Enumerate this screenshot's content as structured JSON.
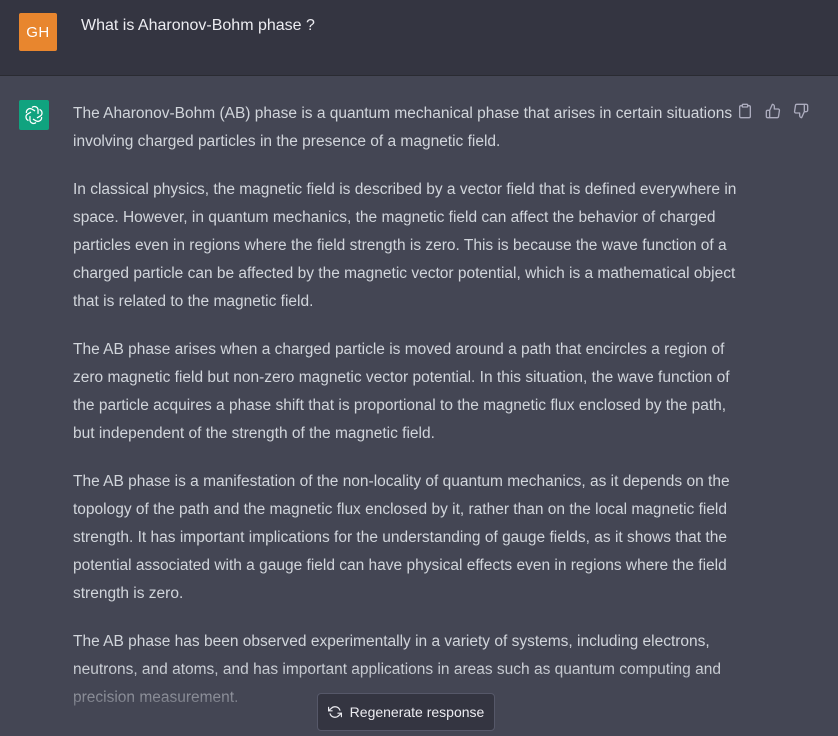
{
  "user": {
    "avatar_initials": "GH",
    "avatar_color": "#e8862e",
    "question": "What is Aharonov-Bohm phase ?"
  },
  "assistant": {
    "avatar_icon": "openai-logo-icon",
    "avatar_color": "#10a37f",
    "paragraphs": [
      "The Aharonov-Bohm (AB) phase is a quantum mechanical phase that arises in certain situations involving charged particles in the presence of a magnetic field.",
      "In classical physics, the magnetic field is described by a vector field that is defined everywhere in space. However, in quantum mechanics, the magnetic field can affect the behavior of charged particles even in regions where the field strength is zero. This is because the wave function of a charged particle can be affected by the magnetic vector potential, which is a mathematical object that is related to the magnetic field.",
      "The AB phase arises when a charged particle is moved around a path that encircles a region of zero magnetic field but non-zero magnetic vector potential. In this situation, the wave function of the particle acquires a phase shift that is proportional to the magnetic flux enclosed by the path, but independent of the strength of the magnetic field.",
      "The AB phase is a manifestation of the non-locality of quantum mechanics, as it depends on the topology of the path and the magnetic flux enclosed by it, rather than on the local magnetic field strength. It has important implications for the understanding of gauge fields, as it shows that the potential associated with a gauge field can have physical effects even in regions where the field strength is zero.",
      "The AB phase has been observed experimentally in a variety of systems, including electrons, neutrons, and atoms, and has important applications in areas such as quantum computing and precision measurement."
    ],
    "actions": [
      "clipboard-icon",
      "thumbs-up-icon",
      "thumbs-down-icon"
    ]
  },
  "footer": {
    "regenerate_label": "Regenerate response",
    "regenerate_icon": "refresh-icon"
  },
  "colors": {
    "user_bg": "#343541",
    "assistant_bg": "#444654",
    "text": "#d1d5db"
  }
}
